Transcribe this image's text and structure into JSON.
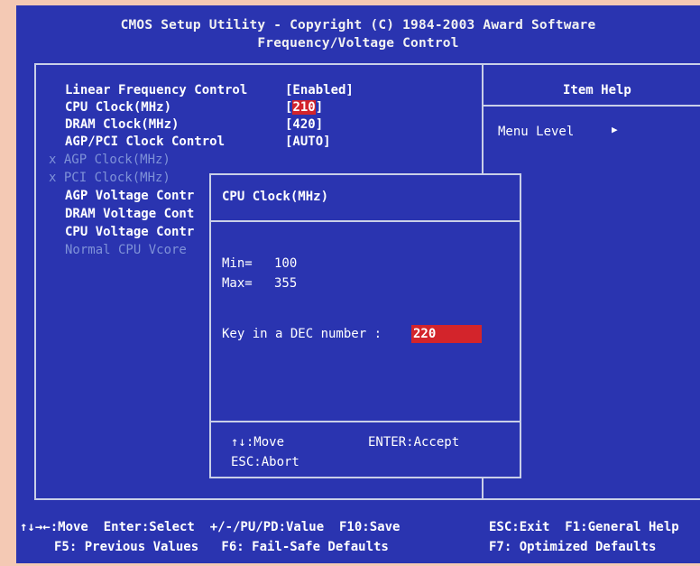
{
  "header": {
    "title": "CMOS Setup Utility - Copyright (C) 1984-2003 Award Software",
    "subtitle": "Frequency/Voltage Control"
  },
  "menu": {
    "items": [
      {
        "label": "Linear Frequency Control",
        "value": "[Enabled]",
        "state": "enabled"
      },
      {
        "label": "CPU Clock(MHz)",
        "value_open": "[",
        "value_selected": "210",
        "value_close": "]",
        "state": "selected"
      },
      {
        "label": "DRAM Clock(MHz)",
        "value": "[420]",
        "state": "enabled"
      },
      {
        "label": "AGP/PCI Clock Control",
        "value": "[AUTO]",
        "state": "enabled"
      },
      {
        "label": "x AGP Clock(MHz)",
        "state": "disabled"
      },
      {
        "label": "x PCI Clock(MHz)",
        "state": "disabled"
      },
      {
        "label": "AGP Voltage Contr",
        "state": "enabled"
      },
      {
        "label": "DRAM Voltage Cont",
        "state": "enabled"
      },
      {
        "label": "CPU Voltage Contr",
        "state": "enabled"
      },
      {
        "label": "Normal CPU Vcore",
        "state": "disabled"
      }
    ]
  },
  "help": {
    "title": "Item Help",
    "menu_level_label": "Menu Level",
    "menu_level_arrow": "▶"
  },
  "popup": {
    "title": "CPU Clock(MHz)",
    "min_label": "Min=",
    "min_value": "100",
    "max_label": "Max=",
    "max_value": "355",
    "prompt": "Key in a DEC number :",
    "input_value": "220",
    "move_hint": "↑↓:Move",
    "accept_hint": "ENTER:Accept",
    "abort_hint": "ESC:Abort"
  },
  "footer": {
    "line1_left": "↑↓→←:Move  Enter:Select  +/-/PU/PD:Value  F10:Save",
    "line1_right": "ESC:Exit  F1:General Help",
    "line2_left": "F5: Previous Values   F6: Fail-Safe Defaults",
    "line2_right": "F7: Optimized Defaults"
  },
  "colors": {
    "background": "#2a34b0",
    "highlight": "#d3242b",
    "text": "#ffffff",
    "disabled_text": "#7f92d8",
    "frame": "#f4c9b4"
  }
}
